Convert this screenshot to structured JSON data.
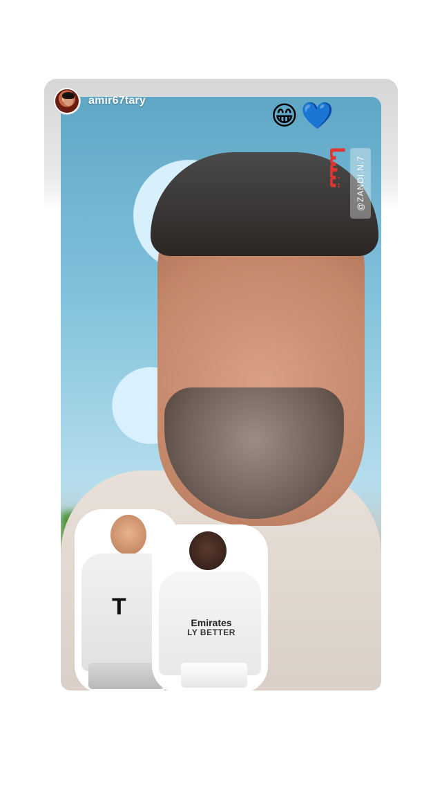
{
  "story": {
    "username": "amir67tary",
    "emojis": [
      "😁",
      "💙"
    ],
    "watermark_brand": "تنسا",
    "watermark_handle": "@ZANDI.N.7",
    "jersey_text": [
      "Emirates",
      "LY BETTER"
    ]
  },
  "colors": {
    "frame_bg": "#d6d6d6",
    "page_bg": "#ffffff",
    "username_text": "#ffffff",
    "brand_red": "#e0362f"
  }
}
